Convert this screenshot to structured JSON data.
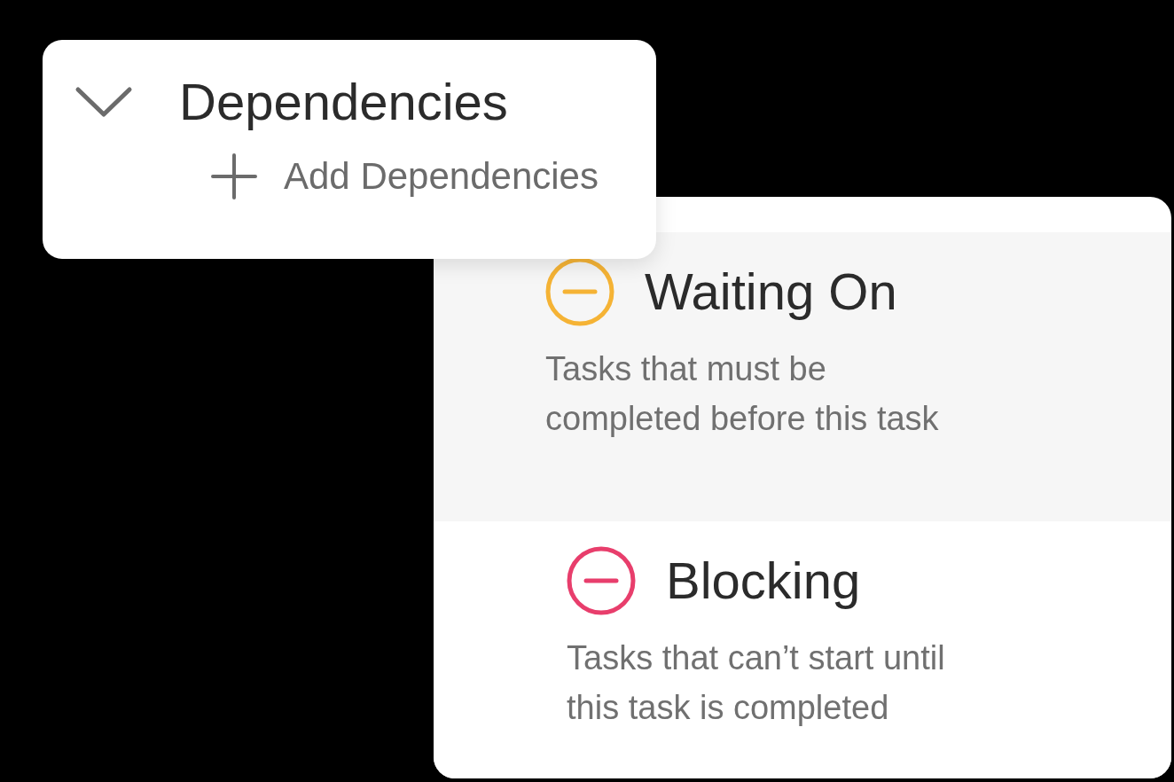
{
  "dependencies_panel": {
    "title": "Dependencies",
    "expanded": true,
    "add_label": "Add Dependencies"
  },
  "dependency_types": [
    {
      "title": "Waiting On",
      "description": "Tasks that must be\ncompleted before this task",
      "color": "#f5b335",
      "selected": true
    },
    {
      "title": "Blocking",
      "description": "Tasks that can’t start until\nthis task is completed",
      "color": "#e83e6c",
      "selected": false
    }
  ]
}
